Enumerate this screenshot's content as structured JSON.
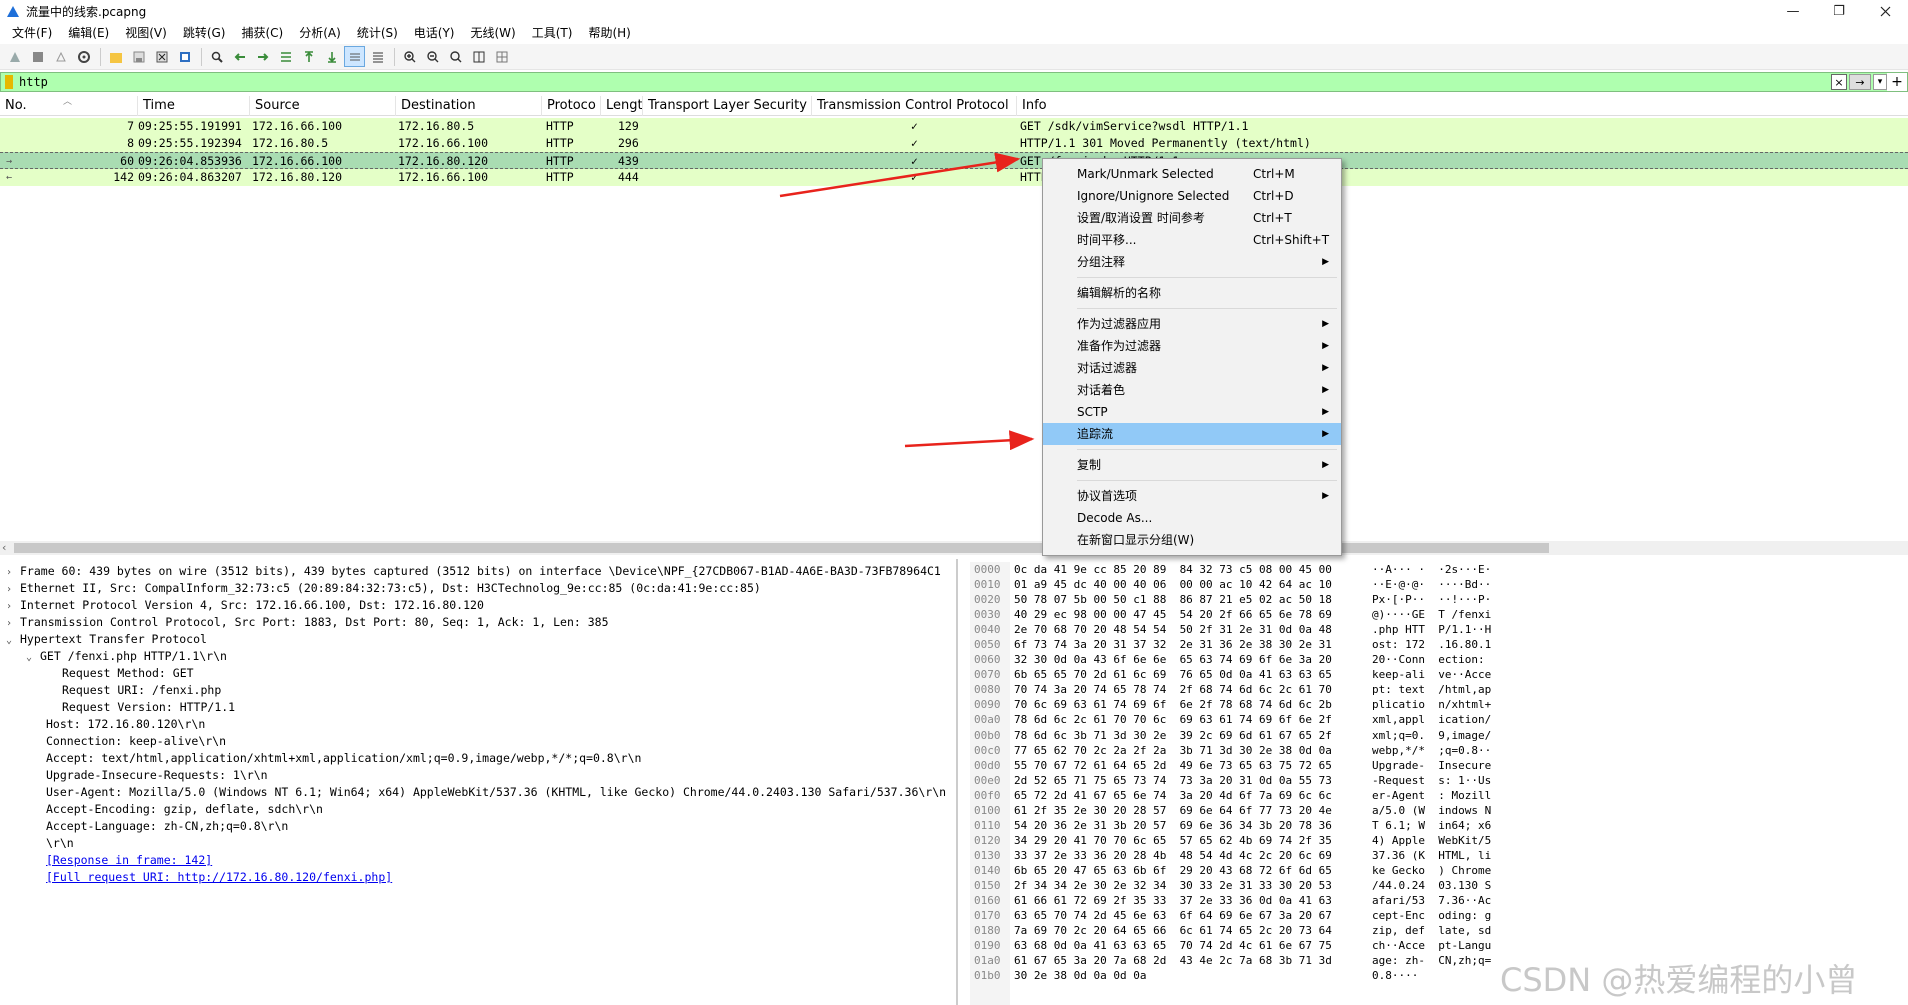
{
  "window": {
    "title": "流量中的线索.pcapng",
    "minimize": "—",
    "restore": "❐",
    "close": ""
  },
  "menu": [
    "文件(F)",
    "编辑(E)",
    "视图(V)",
    "跳转(G)",
    "捕获(C)",
    "分析(A)",
    "统计(S)",
    "电话(Y)",
    "无线(W)",
    "工具(T)",
    "帮助(H)"
  ],
  "filter": {
    "value": "http",
    "clear_icon": "×",
    "apply_icon": "→",
    "dropdown_icon": "▾",
    "add_icon": "+"
  },
  "packet_list": {
    "columns": [
      "No.",
      "Time",
      "Source",
      "Destination",
      "Protoco",
      "Lengt",
      "Transport Layer Security",
      "Transmission Control Protocol",
      "Info"
    ],
    "rows": [
      {
        "no": "7",
        "time": "09:25:55.191991",
        "src": "172.16.66.100",
        "dst": "172.16.80.5",
        "proto": "HTTP",
        "len": "129",
        "tls": "",
        "tcp": "✓",
        "info": "GET /sdk/vimService?wsdl HTTP/1.1",
        "related": ""
      },
      {
        "no": "8",
        "time": "09:25:55.192394",
        "src": "172.16.80.5",
        "dst": "172.16.66.100",
        "proto": "HTTP",
        "len": "296",
        "tls": "",
        "tcp": "✓",
        "info": "HTTP/1.1 301 Moved Permanently  (text/html)",
        "related": ""
      },
      {
        "no": "60",
        "time": "09:26:04.853936",
        "src": "172.16.66.100",
        "dst": "172.16.80.120",
        "proto": "HTTP",
        "len": "439",
        "tls": "",
        "tcp": "✓",
        "info": "GET /fenxi.php HTTP/1.1",
        "related": "→"
      },
      {
        "no": "142",
        "time": "09:26:04.863207",
        "src": "172.16.80.120",
        "dst": "172.16.66.100",
        "proto": "HTTP",
        "len": "444",
        "tls": "",
        "tcp": "✓",
        "info": "HTTP/1.1 200 OK",
        "related": "←"
      }
    ]
  },
  "details": [
    {
      "toggle": "›",
      "text": "Frame 60: 439 bytes on wire (3512 bits), 439 bytes captured (3512 bits) on interface \\Device\\NPF_{27CDB067-B1AD-4A6E-BA3D-73FB78964C1",
      "indent": 0,
      "link": false
    },
    {
      "toggle": "›",
      "text": "Ethernet II, Src: CompalInform_32:73:c5 (20:89:84:32:73:c5), Dst: H3CTechnolog_9e:cc:85 (0c:da:41:9e:cc:85)",
      "indent": 0,
      "link": false
    },
    {
      "toggle": "›",
      "text": "Internet Protocol Version 4, Src: 172.16.66.100, Dst: 172.16.80.120",
      "indent": 0,
      "link": false
    },
    {
      "toggle": "›",
      "text": "Transmission Control Protocol, Src Port: 1883, Dst Port: 80, Seq: 1, Ack: 1, Len: 385",
      "indent": 0,
      "link": false
    },
    {
      "toggle": "⌄",
      "text": "Hypertext Transfer Protocol",
      "indent": 0,
      "link": false
    },
    {
      "toggle": "⌄",
      "text": "GET /fenxi.php HTTP/1.1\\r\\n",
      "indent": 1,
      "link": false
    },
    {
      "toggle": "",
      "text": "Request Method: GET",
      "indent": 3,
      "link": false
    },
    {
      "toggle": "",
      "text": "Request URI: /fenxi.php",
      "indent": 3,
      "link": false
    },
    {
      "toggle": "",
      "text": "Request Version: HTTP/1.1",
      "indent": 3,
      "link": false
    },
    {
      "toggle": "",
      "text": "Host: 172.16.80.120\\r\\n",
      "indent": 2,
      "link": false
    },
    {
      "toggle": "",
      "text": "Connection: keep-alive\\r\\n",
      "indent": 2,
      "link": false
    },
    {
      "toggle": "",
      "text": "Accept: text/html,application/xhtml+xml,application/xml;q=0.9,image/webp,*/*;q=0.8\\r\\n",
      "indent": 2,
      "link": false
    },
    {
      "toggle": "",
      "text": "Upgrade-Insecure-Requests: 1\\r\\n",
      "indent": 2,
      "link": false
    },
    {
      "toggle": "",
      "text": "User-Agent: Mozilla/5.0 (Windows NT 6.1; Win64; x64) AppleWebKit/537.36 (KHTML, like Gecko) Chrome/44.0.2403.130 Safari/537.36\\r\\n",
      "indent": 2,
      "link": false
    },
    {
      "toggle": "",
      "text": "Accept-Encoding: gzip, deflate, sdch\\r\\n",
      "indent": 2,
      "link": false
    },
    {
      "toggle": "",
      "text": "Accept-Language: zh-CN,zh;q=0.8\\r\\n",
      "indent": 2,
      "link": false
    },
    {
      "toggle": "",
      "text": "\\r\\n",
      "indent": 2,
      "link": false
    },
    {
      "toggle": "",
      "text": "[Response in frame: 142]",
      "indent": 2,
      "link": true
    },
    {
      "toggle": "",
      "text": "[Full request URI: http://172.16.80.120/fenxi.php]",
      "indent": 2,
      "link": true
    }
  ],
  "bytes": {
    "offsets": [
      "0000",
      "0010",
      "0020",
      "0030",
      "0040",
      "0050",
      "0060",
      "0070",
      "0080",
      "0090",
      "00a0",
      "00b0",
      "00c0",
      "00d0",
      "00e0",
      "00f0",
      "0100",
      "0110",
      "0120",
      "0130",
      "0140",
      "0150",
      "0160",
      "0170",
      "0180",
      "0190",
      "01a0",
      "01b0"
    ],
    "hex": [
      "0c da 41 9e cc 85 20 89  84 32 73 c5 08 00 45 00",
      "01 a9 45 dc 40 00 40 06  00 00 ac 10 42 64 ac 10",
      "50 78 07 5b 00 50 c1 88  86 87 21 e5 02 ac 50 18",
      "40 29 ec 98 00 00 47 45  54 20 2f 66 65 6e 78 69",
      "2e 70 68 70 20 48 54 54  50 2f 31 2e 31 0d 0a 48",
      "6f 73 74 3a 20 31 37 32  2e 31 36 2e 38 30 2e 31",
      "32 30 0d 0a 43 6f 6e 6e  65 63 74 69 6f 6e 3a 20",
      "6b 65 65 70 2d 61 6c 69  76 65 0d 0a 41 63 63 65",
      "70 74 3a 20 74 65 78 74  2f 68 74 6d 6c 2c 61 70",
      "70 6c 69 63 61 74 69 6f  6e 2f 78 68 74 6d 6c 2b",
      "78 6d 6c 2c 61 70 70 6c  69 63 61 74 69 6f 6e 2f",
      "78 6d 6c 3b 71 3d 30 2e  39 2c 69 6d 61 67 65 2f",
      "77 65 62 70 2c 2a 2f 2a  3b 71 3d 30 2e 38 0d 0a",
      "55 70 67 72 61 64 65 2d  49 6e 73 65 63 75 72 65",
      "2d 52 65 71 75 65 73 74  73 3a 20 31 0d 0a 55 73",
      "65 72 2d 41 67 65 6e 74  3a 20 4d 6f 7a 69 6c 6c",
      "61 2f 35 2e 30 20 28 57  69 6e 64 6f 77 73 20 4e",
      "54 20 36 2e 31 3b 20 57  69 6e 36 34 3b 20 78 36",
      "34 29 20 41 70 70 6c 65  57 65 62 4b 69 74 2f 35",
      "33 37 2e 33 36 20 28 4b  48 54 4d 4c 2c 20 6c 69",
      "6b 65 20 47 65 63 6b 6f  29 20 43 68 72 6f 6d 65",
      "2f 34 34 2e 30 2e 32 34  30 33 2e 31 33 30 20 53",
      "61 66 61 72 69 2f 35 33  37 2e 33 36 0d 0a 41 63",
      "63 65 70 74 2d 45 6e 63  6f 64 69 6e 67 3a 20 67",
      "7a 69 70 2c 20 64 65 66  6c 61 74 65 2c 20 73 64",
      "63 68 0d 0a 41 63 63 65  70 74 2d 4c 61 6e 67 75",
      "61 67 65 3a 20 7a 68 2d  43 4e 2c 7a 68 3b 71 3d",
      "30 2e 38 0d 0a 0d 0a"
    ],
    "ascii": [
      "··A··· ·  ·2s···E·",
      "··E·@·@·  ····Bd··",
      "Px·[·P··  ··!···P·",
      "@)····GE  T /fenxi",
      ".php HTT  P/1.1··H",
      "ost: 172  .16.80.1",
      "20··Conn  ection: ",
      "keep-ali  ve··Acce",
      "pt: text  /html,ap",
      "plicatio  n/xhtml+",
      "xml,appl  ication/",
      "xml;q=0.  9,image/",
      "webp,*/*  ;q=0.8··",
      "Upgrade-  Insecure",
      "-Request  s: 1··Us",
      "er-Agent  : Mozill",
      "a/5.0 (W  indows N",
      "T 6.1; W  in64; x6",
      "4) Apple  WebKit/5",
      "37.36 (K  HTML, li",
      "ke Gecko  ) Chrome",
      "/44.0.24  03.130 S",
      "afari/53  7.36··Ac",
      "cept-Enc  oding: g",
      "zip, def  late, sd",
      "ch··Acce  pt-Langu",
      "age: zh-  CN,zh;q=",
      "0.8····"
    ]
  },
  "context_menu": [
    {
      "label": "Mark/Unmark Selected",
      "shortcut": "Ctrl+M",
      "submenu": false,
      "highlight": false,
      "sep_after": false
    },
    {
      "label": "Ignore/Unignore Selected",
      "shortcut": "Ctrl+D",
      "submenu": false,
      "highlight": false,
      "sep_after": false
    },
    {
      "label": "设置/取消设置 时间参考",
      "shortcut": "Ctrl+T",
      "submenu": false,
      "highlight": false,
      "sep_after": false
    },
    {
      "label": "时间平移...",
      "shortcut": "Ctrl+Shift+T",
      "submenu": false,
      "highlight": false,
      "sep_after": false
    },
    {
      "label": "分组注释",
      "shortcut": "",
      "submenu": true,
      "highlight": false,
      "sep_after": true
    },
    {
      "label": "编辑解析的名称",
      "shortcut": "",
      "submenu": false,
      "highlight": false,
      "sep_after": true
    },
    {
      "label": "作为过滤器应用",
      "shortcut": "",
      "submenu": true,
      "highlight": false,
      "sep_after": false
    },
    {
      "label": "准备作为过滤器",
      "shortcut": "",
      "submenu": true,
      "highlight": false,
      "sep_after": false
    },
    {
      "label": "对话过滤器",
      "shortcut": "",
      "submenu": true,
      "highlight": false,
      "sep_after": false
    },
    {
      "label": "对话着色",
      "shortcut": "",
      "submenu": true,
      "highlight": false,
      "sep_after": false
    },
    {
      "label": "SCTP",
      "shortcut": "",
      "submenu": true,
      "highlight": false,
      "sep_after": false
    },
    {
      "label": "追踪流",
      "shortcut": "",
      "submenu": true,
      "highlight": true,
      "sep_after": true
    },
    {
      "label": "复制",
      "shortcut": "",
      "submenu": true,
      "highlight": false,
      "sep_after": true
    },
    {
      "label": "协议首选项",
      "shortcut": "",
      "submenu": true,
      "highlight": false,
      "sep_after": false
    },
    {
      "label": "Decode As...",
      "shortcut": "",
      "submenu": false,
      "highlight": false,
      "sep_after": false
    },
    {
      "label": "在新窗口显示分组(W)",
      "shortcut": "",
      "submenu": false,
      "highlight": false,
      "sep_after": false
    }
  ],
  "watermark": "CSDN @热爱编程的小曾",
  "colors": {
    "row_bg": "#e4ffc7",
    "selected_row_bg": "#a9dcb2",
    "filter_bg": "#afffaf",
    "menu_highlight": "#91c9f7",
    "annotation_arrow": "#e8231c"
  }
}
